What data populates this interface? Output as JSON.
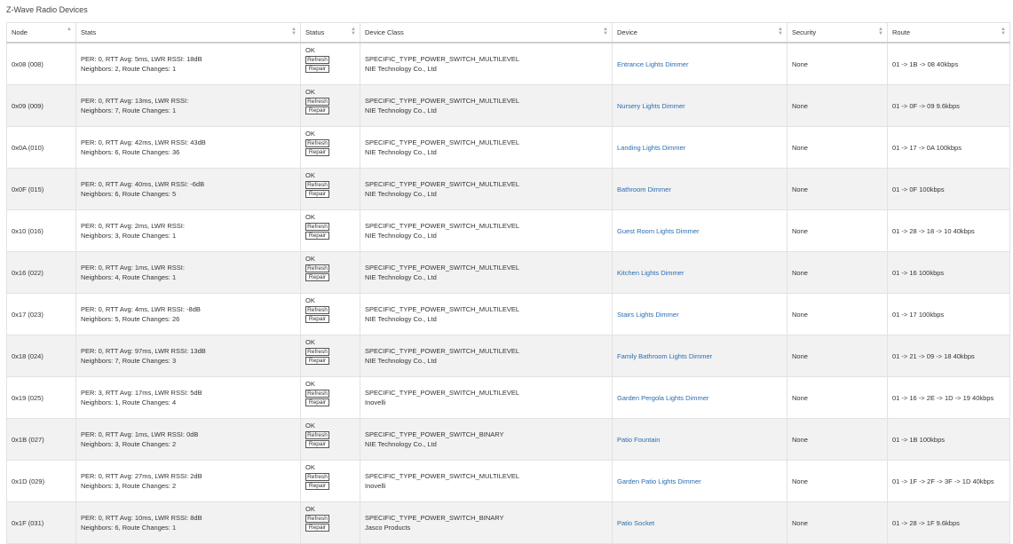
{
  "page": {
    "title": "Z-Wave Radio Devices"
  },
  "table": {
    "headers": {
      "node": "Node",
      "stats": "Stats",
      "status": "Status",
      "device_class": "Device Class",
      "device": "Device",
      "security": "Security",
      "route": "Route"
    },
    "rows": [
      {
        "node": "0x08 (008)",
        "stats1": "PER: 0, RTT Avg: 5ms, LWR RSSI: 18dB",
        "stats2": "Neighbors: 2, Route Changes: 1",
        "status": "OK",
        "refresh": "Refresh",
        "repair": "Repair",
        "class1": "SPECIFIC_TYPE_POWER_SWITCH_MULTILEVEL",
        "class2": "NIE Technology Co., Ltd",
        "device": "Entrance Lights Dimmer",
        "security": "None",
        "route": "01 -> 1B -> 08 40kbps"
      },
      {
        "node": "0x09 (009)",
        "stats1": "PER: 0, RTT Avg: 13ms, LWR RSSI:",
        "stats2": "Neighbors: 7, Route Changes: 1",
        "status": "OK",
        "refresh": "Refresh",
        "repair": "Repair",
        "class1": "SPECIFIC_TYPE_POWER_SWITCH_MULTILEVEL",
        "class2": "NIE Technology Co., Ltd",
        "device": "Nursery Lights Dimmer",
        "security": "None",
        "route": "01 -> 0F -> 09 9.6kbps"
      },
      {
        "node": "0x0A (010)",
        "stats1": "PER: 0, RTT Avg: 42ms, LWR RSSI: 43dB",
        "stats2": "Neighbors: 6, Route Changes: 36",
        "status": "OK",
        "refresh": "Refresh",
        "repair": "Repair",
        "class1": "SPECIFIC_TYPE_POWER_SWITCH_MULTILEVEL",
        "class2": "NIE Technology Co., Ltd",
        "device": "Landing Lights Dimmer",
        "security": "None",
        "route": "01 -> 17 -> 0A 100kbps"
      },
      {
        "node": "0x0F (015)",
        "stats1": "PER: 0, RTT Avg: 40ms, LWR RSSI: -6dB",
        "stats2": "Neighbors: 6, Route Changes: 5",
        "status": "OK",
        "refresh": "Refresh",
        "repair": "Repair",
        "class1": "SPECIFIC_TYPE_POWER_SWITCH_MULTILEVEL",
        "class2": "NIE Technology Co., Ltd",
        "device": "Bathroom Dimmer",
        "security": "None",
        "route": "01 -> 0F 100kbps"
      },
      {
        "node": "0x10 (016)",
        "stats1": "PER: 0, RTT Avg: 2ms, LWR RSSI:",
        "stats2": "Neighbors: 3, Route Changes: 1",
        "status": "OK",
        "refresh": "Refresh",
        "repair": "Repair",
        "class1": "SPECIFIC_TYPE_POWER_SWITCH_MULTILEVEL",
        "class2": "NIE Technology Co., Ltd",
        "device": "Guest Room Lights Dimmer",
        "security": "None",
        "route": "01 -> 28 -> 18 -> 10 40kbps"
      },
      {
        "node": "0x16 (022)",
        "stats1": "PER: 0, RTT Avg: 1ms, LWR RSSI:",
        "stats2": "Neighbors: 4, Route Changes: 1",
        "status": "OK",
        "refresh": "Refresh",
        "repair": "Repair",
        "class1": "SPECIFIC_TYPE_POWER_SWITCH_MULTILEVEL",
        "class2": "NIE Technology Co., Ltd",
        "device": "Kitchen Lights Dimmer",
        "security": "None",
        "route": "01 -> 16 100kbps"
      },
      {
        "node": "0x17 (023)",
        "stats1": "PER: 0, RTT Avg: 4ms, LWR RSSI: -8dB",
        "stats2": "Neighbors: 5, Route Changes: 26",
        "status": "OK",
        "refresh": "Refresh",
        "repair": "Repair",
        "class1": "SPECIFIC_TYPE_POWER_SWITCH_MULTILEVEL",
        "class2": "NIE Technology Co., Ltd",
        "device": "Stairs Lights Dimmer",
        "security": "None",
        "route": "01 -> 17 100kbps"
      },
      {
        "node": "0x18 (024)",
        "stats1": "PER: 0, RTT Avg: 97ms, LWR RSSI: 13dB",
        "stats2": "Neighbors: 7, Route Changes: 3",
        "status": "OK",
        "refresh": "Refresh",
        "repair": "Repair",
        "class1": "SPECIFIC_TYPE_POWER_SWITCH_MULTILEVEL",
        "class2": "NIE Technology Co., Ltd",
        "device": "Family Bathroom Lights Dimmer",
        "security": "None",
        "route": "01 -> 21 -> 09 -> 18 40kbps"
      },
      {
        "node": "0x19 (025)",
        "stats1": "PER: 3, RTT Avg: 17ms, LWR RSSI: 5dB",
        "stats2": "Neighbors: 1, Route Changes: 4",
        "status": "OK",
        "refresh": "Refresh",
        "repair": "Repair",
        "class1": "SPECIFIC_TYPE_POWER_SWITCH_MULTILEVEL",
        "class2": "Inovelli",
        "device": "Garden Pergola Lights Dimmer",
        "security": "None",
        "route": "01 -> 16 -> 2E -> 1D -> 19 40kbps"
      },
      {
        "node": "0x1B (027)",
        "stats1": "PER: 0, RTT Avg: 1ms, LWR RSSI: 0dB",
        "stats2": "Neighbors: 3, Route Changes: 2",
        "status": "OK",
        "refresh": "Refresh",
        "repair": "Repair",
        "class1": "SPECIFIC_TYPE_POWER_SWITCH_BINARY",
        "class2": "NIE Technology Co., Ltd",
        "device": "Patio Fountain",
        "security": "None",
        "route": "01 -> 1B 100kbps"
      },
      {
        "node": "0x1D (029)",
        "stats1": "PER: 0, RTT Avg: 27ms, LWR RSSI: 2dB",
        "stats2": "Neighbors: 3, Route Changes: 2",
        "status": "OK",
        "refresh": "Refresh",
        "repair": "Repair",
        "class1": "SPECIFIC_TYPE_POWER_SWITCH_MULTILEVEL",
        "class2": "Inovelli",
        "device": "Garden Patio Lights Dimmer",
        "security": "None",
        "route": "01 -> 1F -> 2F -> 3F -> 1D 40kbps"
      },
      {
        "node": "0x1F (031)",
        "stats1": "PER: 0, RTT Avg: 10ms, LWR RSSI: 8dB",
        "stats2": "Neighbors: 6, Route Changes: 1",
        "status": "OK",
        "refresh": "Refresh",
        "repair": "Repair",
        "class1": "SPECIFIC_TYPE_POWER_SWITCH_BINARY",
        "class2": "Jasco Products",
        "device": "Patio Socket",
        "security": "None",
        "route": "01 -> 28 -> 1F 9.6kbps"
      }
    ]
  },
  "colors": {
    "link": "#2a6cb0",
    "row_alt": "#f2f2f2",
    "border": "#e2e2e2"
  }
}
